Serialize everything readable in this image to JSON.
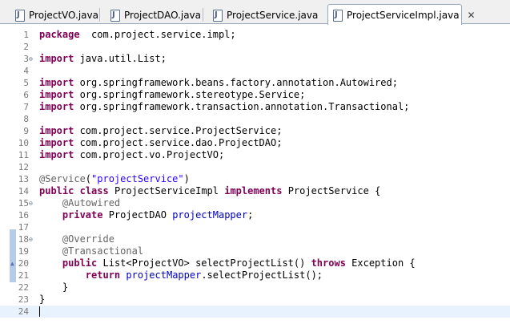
{
  "tabs": [
    {
      "label": "ProjectVO.java"
    },
    {
      "label": "ProjectDAO.java"
    },
    {
      "label": "ProjectService.java"
    },
    {
      "label": "ProjectServiceImpl.java"
    }
  ],
  "close_glyph": "✕",
  "lines": [
    {
      "num": "1",
      "parts": [
        [
          "kw",
          "package"
        ],
        [
          "",
          "  com.project.service.impl;"
        ]
      ]
    },
    {
      "num": "2",
      "parts": []
    },
    {
      "num": "3",
      "fold": "⊖",
      "parts": [
        [
          "kw",
          "import"
        ],
        [
          "",
          " java.util.List;"
        ]
      ]
    },
    {
      "num": "4",
      "parts": []
    },
    {
      "num": "5",
      "parts": [
        [
          "kw",
          "import"
        ],
        [
          "",
          " org.springframework.beans.factory.annotation.Autowired;"
        ]
      ]
    },
    {
      "num": "6",
      "parts": [
        [
          "kw",
          "import"
        ],
        [
          "",
          " org.springframework.stereotype.Service;"
        ]
      ]
    },
    {
      "num": "7",
      "parts": [
        [
          "kw",
          "import"
        ],
        [
          "",
          " org.springframework.transaction.annotation.Transactional;"
        ]
      ]
    },
    {
      "num": "8",
      "parts": []
    },
    {
      "num": "9",
      "parts": [
        [
          "kw",
          "import"
        ],
        [
          "",
          " com.project.service.ProjectService;"
        ]
      ]
    },
    {
      "num": "10",
      "parts": [
        [
          "kw",
          "import"
        ],
        [
          "",
          " com.project.service.dao.ProjectDAO;"
        ]
      ]
    },
    {
      "num": "11",
      "parts": [
        [
          "kw",
          "import"
        ],
        [
          "",
          " com.project.vo.ProjectVO;"
        ]
      ]
    },
    {
      "num": "12",
      "parts": []
    },
    {
      "num": "13",
      "parts": [
        [
          "ann",
          "@Service"
        ],
        [
          "",
          "("
        ],
        [
          "str",
          "\"projectService\""
        ],
        [
          "",
          ")"
        ]
      ]
    },
    {
      "num": "14",
      "parts": [
        [
          "kw",
          "public"
        ],
        [
          "",
          " "
        ],
        [
          "kw",
          "class"
        ],
        [
          "",
          " ProjectServiceImpl "
        ],
        [
          "kw",
          "implements"
        ],
        [
          "",
          " ProjectService {"
        ]
      ]
    },
    {
      "num": "15",
      "fold": "⊖",
      "parts": [
        [
          "",
          "    "
        ],
        [
          "ann",
          "@Autowired"
        ]
      ]
    },
    {
      "num": "16",
      "parts": [
        [
          "",
          "    "
        ],
        [
          "kw",
          "private"
        ],
        [
          "",
          " ProjectDAO "
        ],
        [
          "fld",
          "projectMapper"
        ],
        [
          "",
          ";"
        ]
      ]
    },
    {
      "num": "17",
      "parts": []
    },
    {
      "num": "18",
      "fold": "⊖",
      "parts": [
        [
          "",
          "    "
        ],
        [
          "ann",
          "@Override"
        ]
      ]
    },
    {
      "num": "19",
      "parts": [
        [
          "",
          "    "
        ],
        [
          "ann",
          "@Transactional"
        ]
      ]
    },
    {
      "num": "20",
      "override": true,
      "parts": [
        [
          "",
          "    "
        ],
        [
          "kw",
          "public"
        ],
        [
          "",
          " List<ProjectVO> selectProjectList() "
        ],
        [
          "kw",
          "throws"
        ],
        [
          "",
          " Exception {"
        ]
      ]
    },
    {
      "num": "21",
      "parts": [
        [
          "",
          "        "
        ],
        [
          "kw",
          "return"
        ],
        [
          "",
          " "
        ],
        [
          "fld",
          "projectMapper"
        ],
        [
          "",
          ".selectProjectList();"
        ]
      ]
    },
    {
      "num": "22",
      "parts": [
        [
          "",
          "    }"
        ]
      ]
    },
    {
      "num": "23",
      "parts": [
        [
          "",
          "}"
        ]
      ]
    },
    {
      "num": "24",
      "current": true,
      "parts": []
    }
  ]
}
